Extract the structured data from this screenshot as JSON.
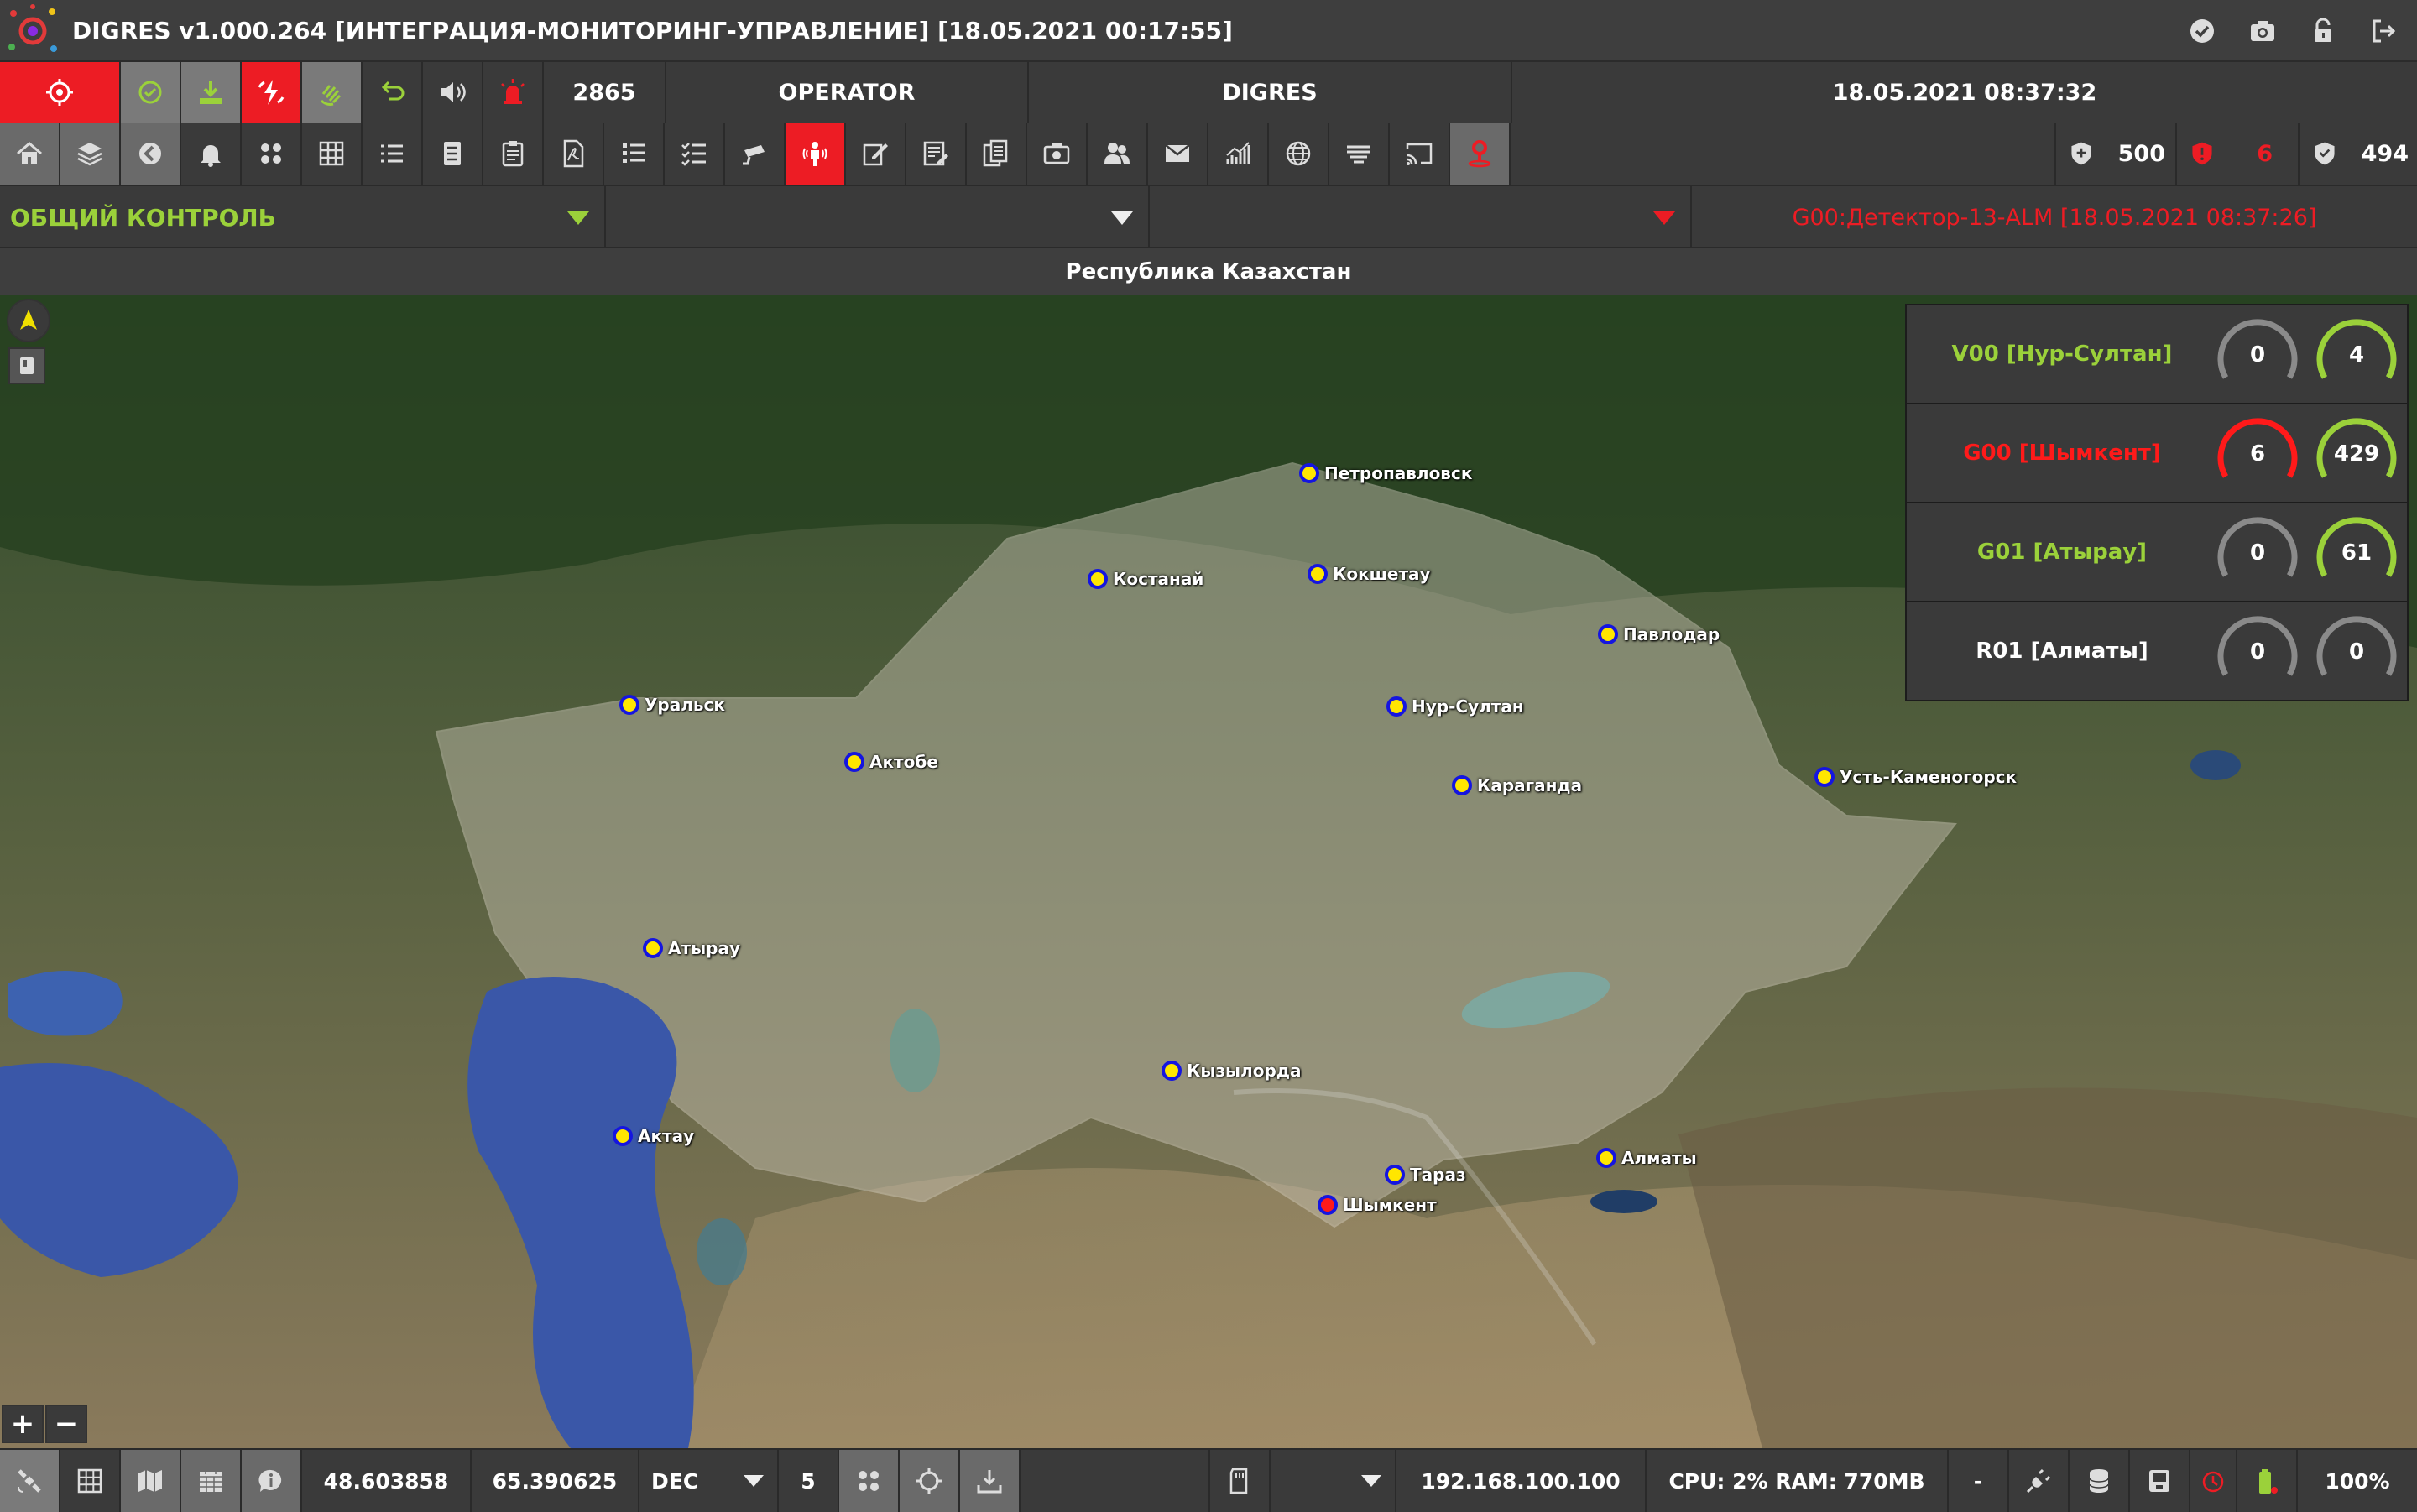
{
  "app": {
    "title": "DIGRES v1.000.264 [ИНТЕГРАЦИЯ-МОНИТОРИНГ-УПРАВЛЕНИЕ] [18.05.2021 00:17:55]",
    "window_icons": [
      "check-circle-icon",
      "camera-icon",
      "lock-icon",
      "logout-icon"
    ]
  },
  "toolbar": {
    "counter": "2865",
    "user": "OPERATOR",
    "system": "DIGRES",
    "datetime": "18.05.2021 08:37:32"
  },
  "counts": {
    "total": "500",
    "alarms": "6",
    "normal": "494"
  },
  "selectors": {
    "group": "ОБЩИЙ КОНТРОЛЬ",
    "second": "",
    "third": "",
    "last_event": "G00:Детектор-13-ALM [18.05.2021 08:37:26]"
  },
  "map": {
    "region_title": "Республика Казахстан",
    "cities": [
      {
        "name": "Петропавловск",
        "alarm": false
      },
      {
        "name": "Костанай",
        "alarm": false
      },
      {
        "name": "Кокшетау",
        "alarm": false
      },
      {
        "name": "Павлодар",
        "alarm": false
      },
      {
        "name": "Уральск",
        "alarm": false
      },
      {
        "name": "Нур-Султан",
        "alarm": false
      },
      {
        "name": "Актобе",
        "alarm": false
      },
      {
        "name": "Караганда",
        "alarm": false
      },
      {
        "name": "Усть-Каменогорск",
        "alarm": false
      },
      {
        "name": "Атырау",
        "alarm": false
      },
      {
        "name": "Кызылорда",
        "alarm": false
      },
      {
        "name": "Актау",
        "alarm": false
      },
      {
        "name": "Тараз",
        "alarm": false
      },
      {
        "name": "Алматы",
        "alarm": false
      },
      {
        "name": "Шымкент",
        "alarm": true
      }
    ]
  },
  "stations": [
    {
      "label": "V00 [Нур-Султан]",
      "color": "#9bd13a",
      "alarms": "0",
      "alarm_color": "#8a8a8a",
      "normal": "4",
      "normal_color": "#9bd13a"
    },
    {
      "label": "G00 [Шымкент]",
      "color": "#ff1a1a",
      "alarms": "6",
      "alarm_color": "#ff1a1a",
      "normal": "429",
      "normal_color": "#9bd13a"
    },
    {
      "label": "G01 [Атырау]",
      "color": "#9bd13a",
      "alarms": "0",
      "alarm_color": "#8a8a8a",
      "normal": "61",
      "normal_color": "#9bd13a"
    },
    {
      "label": "R01 [Алматы]",
      "color": "#ffffff",
      "alarms": "0",
      "alarm_color": "#8a8a8a",
      "normal": "0",
      "normal_color": "#8a8a8a"
    }
  ],
  "statusbar": {
    "latitude": "48.603858",
    "longitude": "65.390625",
    "coord_format": "DEC",
    "precision": "5",
    "ip": "192.168.100.100",
    "resources": "CPU: 2% RAM: 770MB",
    "dash": "-",
    "zoom": "100%"
  },
  "colors": {
    "alarm_red": "#ed1c24",
    "ok_green": "#9bd13a",
    "panel": "#3a3a3a"
  }
}
